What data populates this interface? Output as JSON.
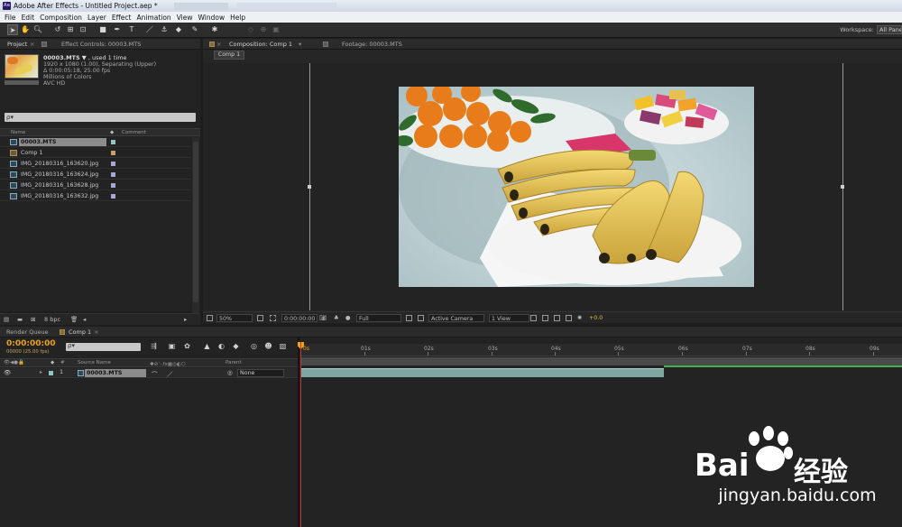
{
  "window": {
    "title": "Adobe After Effects - Untitled Project.aep *"
  },
  "menu": [
    "File",
    "Edit",
    "Composition",
    "Layer",
    "Effect",
    "Animation",
    "View",
    "Window",
    "Help"
  ],
  "toolbar": {
    "workspace_label": "Workspace:",
    "workspace_value": "All Panels"
  },
  "project_panel": {
    "tab_project": "Project",
    "tab_effect_controls": "Effect Controls: 00003.MTS",
    "asset": {
      "name": "00003.MTS",
      "used": "▼ , used 1 time",
      "line1": "1920 x 1080 (1.00), Separating (Upper)",
      "line2": "Δ 0:00:05:18, 25.00 fps",
      "line3": "Millions of Colors",
      "line4": "AVC HD"
    },
    "search_icon": "ρ▾",
    "col_name": "Name",
    "col_comment": "Comment",
    "items": [
      {
        "name": "00003.MTS",
        "label_color": "#8fc7c7"
      },
      {
        "name": "Comp 1",
        "label_color": "#c8a26b"
      },
      {
        "name": "IMG_20180316_163620.jpg",
        "label_color": "#a8a8d8"
      },
      {
        "name": "IMG_20180316_163624.jpg",
        "label_color": "#a8a8d8"
      },
      {
        "name": "IMG_20180316_163628.jpg",
        "label_color": "#a8a8d8"
      },
      {
        "name": "IMG_20180316_163632.jpg",
        "label_color": "#a8a8d8"
      }
    ],
    "footer_bpc": "8 bpc"
  },
  "composition_panel": {
    "tab_comp": "Composition: Comp 1",
    "tab_footage": "Footage: 00003.MTS",
    "subtab": "Comp 1",
    "zoom": "50%",
    "timecode": "0:00:00:00",
    "resolution": "Full",
    "camera": "Active Camera",
    "view": "1 View",
    "exposure": "+0.0"
  },
  "timeline": {
    "tab_render_queue": "Render Queue",
    "tab_comp": "Comp 1",
    "timecode": "0:00:00:00",
    "timecode_sub": "00000 (25.00 fps)",
    "search_icon": "ρ▾",
    "col_source": "Source Name",
    "col_parent": "Parent",
    "col_num": "#",
    "layer": {
      "num": "1",
      "name": "00003.MTS",
      "parent": "None"
    },
    "ruler": [
      "0s",
      "01s",
      "02s",
      "03s",
      "04s",
      "05s",
      "06s",
      "07s",
      "08s",
      "09s"
    ]
  },
  "watermark": {
    "text": "Bai",
    "text2": "经验",
    "url": "jingyan.baidu.com"
  }
}
